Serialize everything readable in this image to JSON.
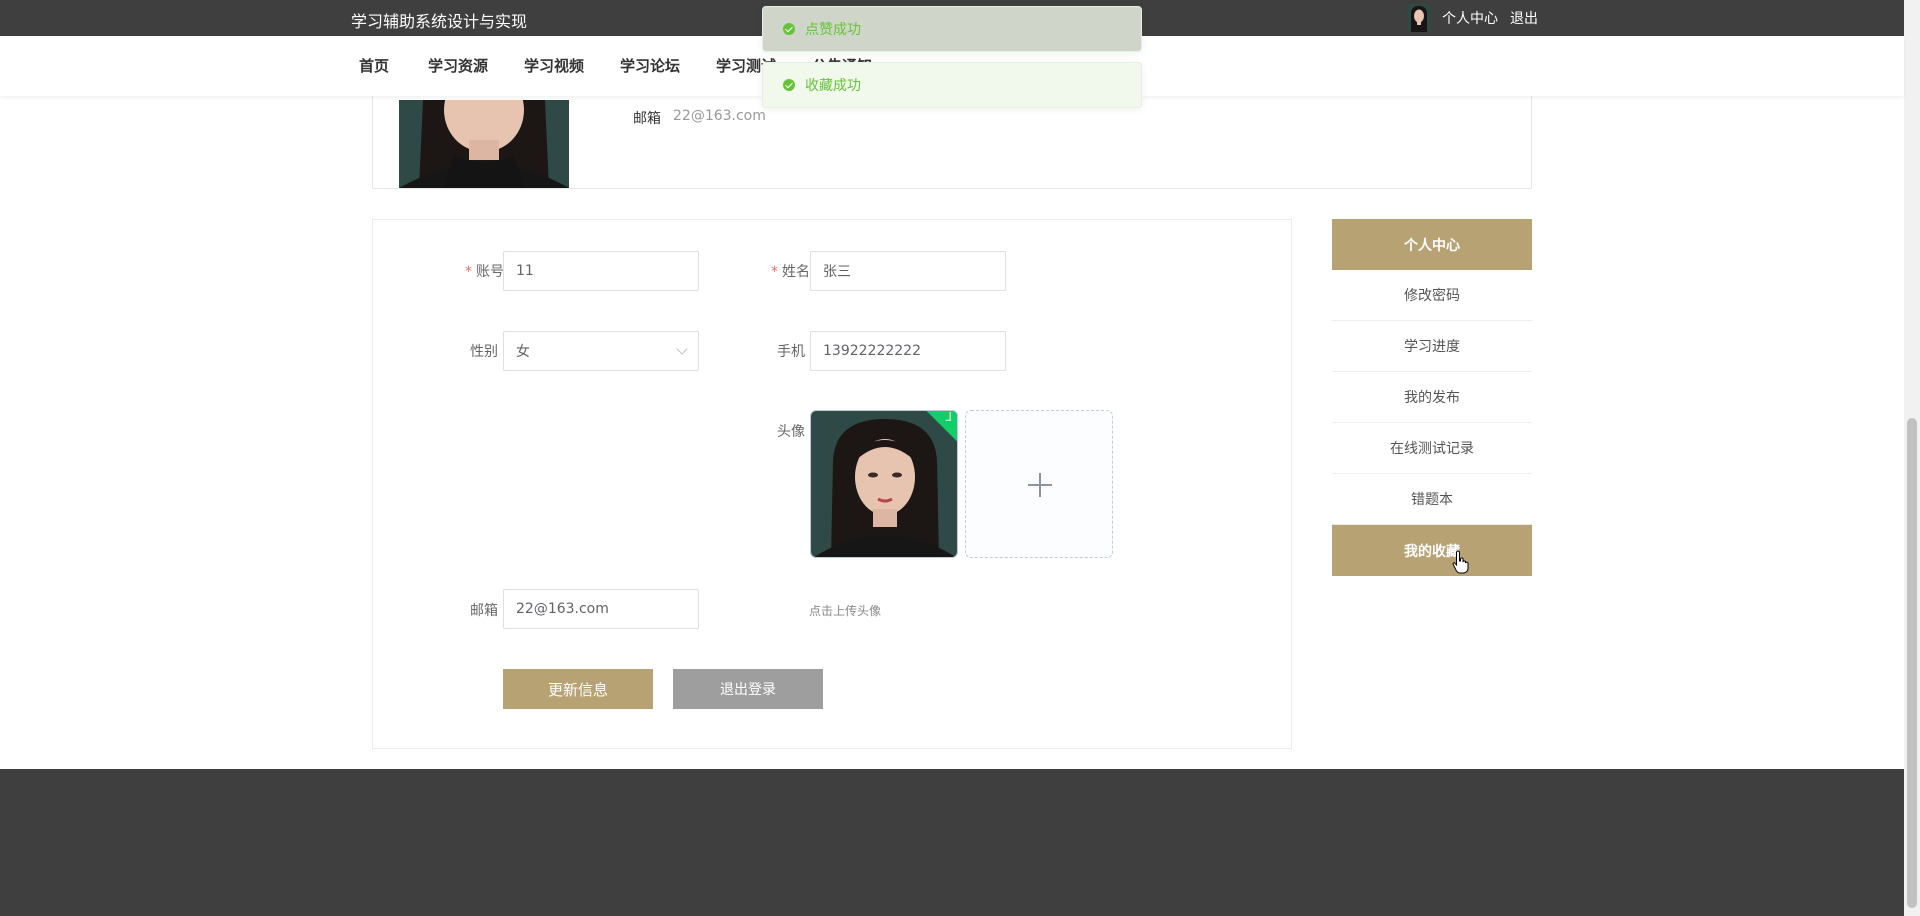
{
  "header": {
    "site_title": "学习辅助系统设计与实现",
    "profile_link": "个人中心",
    "logout_link": "退出"
  },
  "nav": {
    "items": [
      "首页",
      "学习资源",
      "学习视频",
      "学习论坛",
      "学习测试",
      "公告通知"
    ]
  },
  "toasts": [
    {
      "text": "点赞成功"
    },
    {
      "text": "收藏成功"
    }
  ],
  "summary": {
    "email_label": "邮箱",
    "email_value": "22@163.com"
  },
  "form": {
    "account_label": "账号",
    "account_value": "11",
    "name_label": "姓名",
    "name_value": "张三",
    "gender_label": "性别",
    "gender_value": "女",
    "phone_label": "手机",
    "phone_value": "13922222222",
    "avatar_label": "头像",
    "email_label": "邮箱",
    "email_value": "22@163.com",
    "upload_tip": "点击上传头像",
    "update_button": "更新信息",
    "logout_button": "退出登录"
  },
  "sidebar": {
    "items": [
      {
        "label": "个人中心",
        "active": true
      },
      {
        "label": "修改密码",
        "active": false
      },
      {
        "label": "学习进度",
        "active": false
      },
      {
        "label": "我的发布",
        "active": false
      },
      {
        "label": "在线测试记录",
        "active": false
      },
      {
        "label": "错题本",
        "active": false
      },
      {
        "label": "我的收藏",
        "active": true
      }
    ]
  },
  "colors": {
    "accent": "#b7a274",
    "topbar": "#3f3f3f",
    "success": "#67c23a"
  }
}
